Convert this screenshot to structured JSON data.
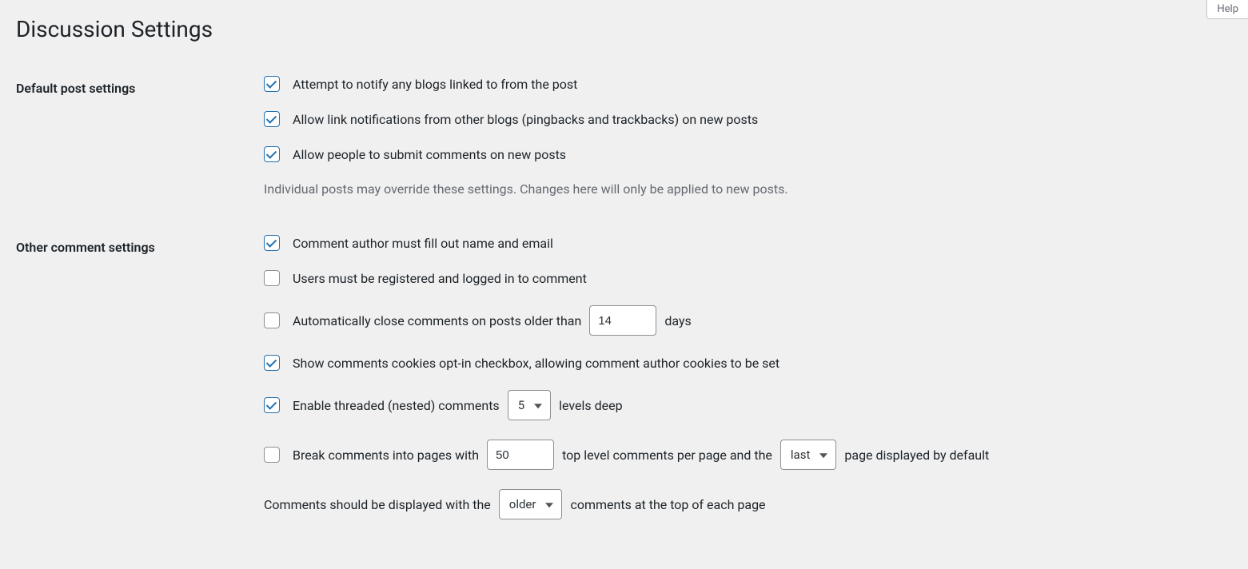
{
  "page": {
    "title": "Discussion Settings",
    "help_label": "Help"
  },
  "sections": {
    "default_post": {
      "heading": "Default post settings",
      "notify_label": "Attempt to notify any blogs linked to from the post",
      "pingback_label": "Allow link notifications from other blogs (pingbacks and trackbacks) on new posts",
      "allow_comments_label": "Allow people to submit comments on new posts",
      "note": "Individual posts may override these settings. Changes here will only be applied to new posts."
    },
    "other_comments": {
      "heading": "Other comment settings",
      "require_name_email_label": "Comment author must fill out name and email",
      "require_registration_label": "Users must be registered and logged in to comment",
      "close_old_label_pre": "Automatically close comments on posts older than",
      "close_old_days_value": "14",
      "close_old_label_post": "days",
      "cookies_label": "Show comments cookies opt-in checkbox, allowing comment author cookies to be set",
      "threaded_label_pre": "Enable threaded (nested) comments",
      "threaded_levels_value": "5",
      "threaded_label_post": "levels deep",
      "pagination_label_pre": "Break comments into pages with",
      "pagination_per_page_value": "50",
      "pagination_label_mid": "top level comments per page and the",
      "pagination_default_page_value": "last",
      "pagination_label_post": "page displayed by default",
      "order_label_pre": "Comments should be displayed with the",
      "order_value": "older",
      "order_label_post": "comments at the top of each page"
    }
  }
}
